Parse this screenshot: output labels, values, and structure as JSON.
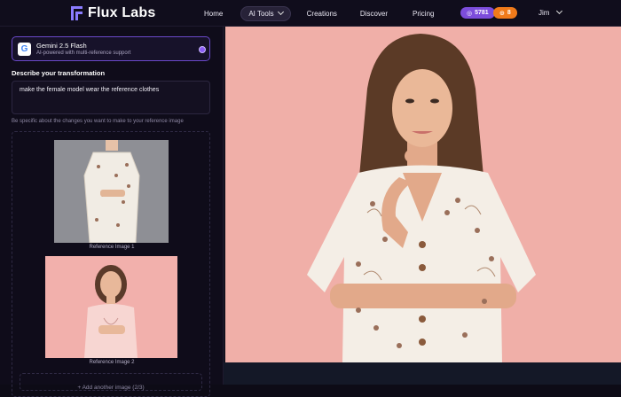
{
  "header": {
    "brand": "Flux Labs",
    "nav": [
      {
        "label": "Home"
      },
      {
        "label": "AI Tools"
      },
      {
        "label": "Creations"
      },
      {
        "label": "Discover"
      },
      {
        "label": "Pricing"
      }
    ],
    "credits": "5781",
    "tokens": "8",
    "user": "Jim"
  },
  "sidebar": {
    "model": {
      "name": "Gemini 2.5 Flash",
      "subtitle": "AI-powered with multi-reference support",
      "icon": "google-icon"
    },
    "describe_label": "Describe your transformation",
    "prompt_value": "make the female model wear the reference clothes",
    "hint": "Be specific about the changes you want to make to your reference image",
    "references": [
      {
        "caption": "Reference Image 1"
      },
      {
        "caption": "Reference Image 2"
      }
    ],
    "add_more": "+ Add another image (2/3)"
  },
  "colors": {
    "accent": "#8b5cf6",
    "credits_badge": "#7c4ddb",
    "tokens_badge": "#f07a1a",
    "photo_background": "#f0afa8"
  }
}
